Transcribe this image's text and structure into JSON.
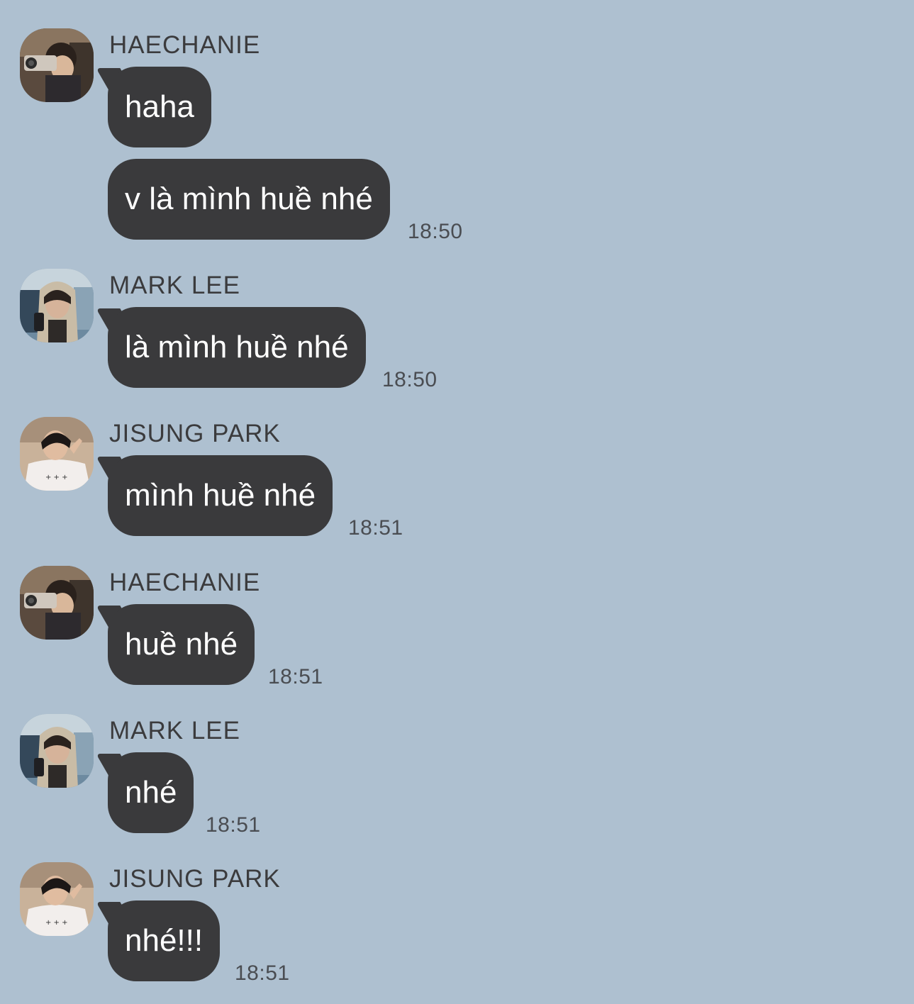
{
  "colors": {
    "background": "#aec0d0",
    "bubble": "#3a3a3c",
    "bubble_text": "#ffffff",
    "sender_text": "#3b3b3d",
    "time_text": "#4a4d52"
  },
  "groups": [
    {
      "sender": "HAECHANIE",
      "avatar": "haechanie-avatar",
      "messages": [
        {
          "text": "haha",
          "time": ""
        },
        {
          "text": "v là mình huề nhé",
          "time": "18:50"
        }
      ]
    },
    {
      "sender": "MARK LEE",
      "avatar": "mark-lee-avatar",
      "messages": [
        {
          "text": "là mình huề nhé",
          "time": "18:50"
        }
      ]
    },
    {
      "sender": "JISUNG PARK",
      "avatar": "jisung-park-avatar",
      "messages": [
        {
          "text": "mình huề nhé",
          "time": "18:51"
        }
      ]
    },
    {
      "sender": "HAECHANIE",
      "avatar": "haechanie-avatar",
      "messages": [
        {
          "text": "huề nhé",
          "time": "18:51"
        }
      ]
    },
    {
      "sender": "MARK LEE",
      "avatar": "mark-lee-avatar",
      "messages": [
        {
          "text": "nhé",
          "time": "18:51"
        }
      ]
    },
    {
      "sender": "JISUNG PARK",
      "avatar": "jisung-park-avatar",
      "messages": [
        {
          "text": "nhé!!!",
          "time": "18:51"
        }
      ]
    }
  ]
}
